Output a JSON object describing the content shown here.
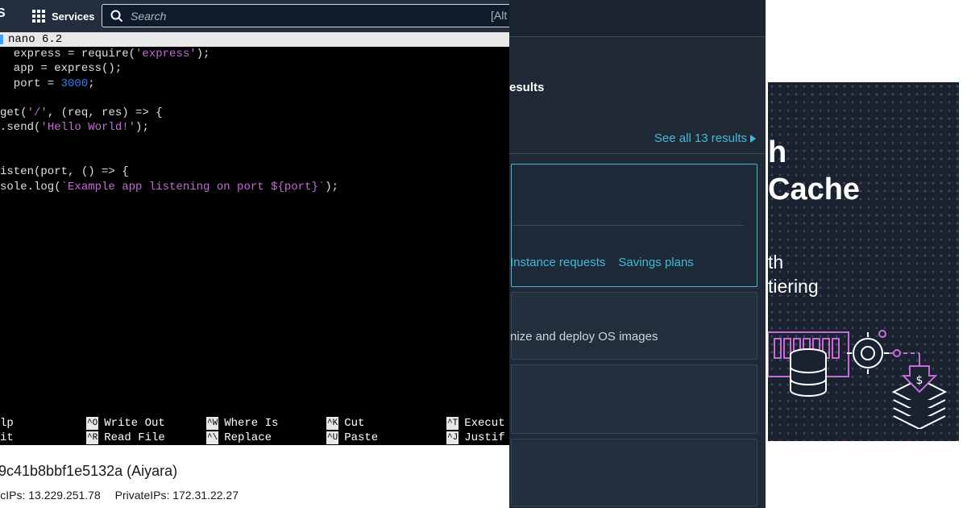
{
  "left_panel": {
    "topbar": {
      "services_label": "Services",
      "search_placeholder": "Search",
      "search_shortcut": "[Alt",
      "icons": [
        "aws-logo",
        "grid-icon",
        "search-icon"
      ]
    },
    "terminal": {
      "title": "  nano 6.2",
      "code_lines": [
        "",
        "",
        "",
        "",
        "",
        "",
        "",
        "",
        "",
        ""
      ],
      "code": {
        "line1": {
          "pre": "  express = require(",
          "str": "'express'",
          "post": ");"
        },
        "line2": {
          "pre": "  app = express();"
        },
        "line3": {
          "pre": "  port = ",
          "num": "3000",
          "post": ";"
        },
        "line5": {
          "pre": "get(",
          "str": "'/'",
          "post": ", (req, res) => {"
        },
        "line6": {
          "pre": ".send(",
          "str": "'Hello World!'",
          "post": ");"
        },
        "line9": {
          "pre": "isten(port, () => {"
        },
        "line10": {
          "pre": "sole.log(",
          "str": "`Example app listening on port ${port}`",
          "post": ");"
        }
      },
      "shortcuts_row1": [
        {
          "key": "",
          "label": "lp"
        },
        {
          "key": "^O",
          "label": "Write Out"
        },
        {
          "key": "^W",
          "label": "Where Is"
        },
        {
          "key": "^K",
          "label": "Cut"
        },
        {
          "key": "^T",
          "label": "Execut"
        }
      ],
      "shortcuts_row2": [
        {
          "key": "",
          "label": "it"
        },
        {
          "key": "^R",
          "label": "Read File"
        },
        {
          "key": "^\\",
          "label": "Replace"
        },
        {
          "key": "^U",
          "label": "Paste"
        },
        {
          "key": "^J",
          "label": "Justif"
        }
      ]
    },
    "instance": {
      "id_text": "9c41b8bbf1e5132a (Aiyara)",
      "public_ips": "licIPs: 13.229.251.78",
      "private_ips": "PrivateIPs: 172.31.22.27"
    }
  },
  "middle_panel": {
    "results_heading": "esults",
    "see_all": "See all 13 results",
    "card1_links": [
      "Instance requests",
      "Savings plans"
    ],
    "card2_description": "nize and deploy OS images"
  },
  "right_panel": {
    "title": "h\nCache",
    "subtitle": "th\ntiering"
  },
  "colors": {
    "aws_navy": "#232f3e",
    "link_blue": "#44b9d6",
    "nano_string": "#c56bd6",
    "nano_number": "#2f7ff0",
    "banner_accent": "#c86bd8"
  }
}
